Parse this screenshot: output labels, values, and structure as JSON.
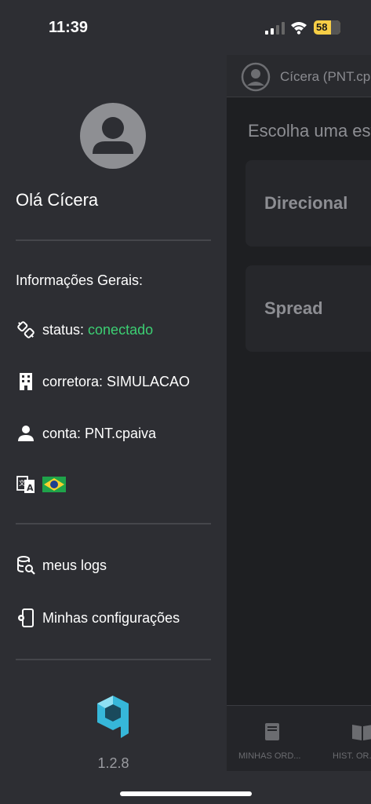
{
  "status_bar": {
    "time": "11:39",
    "battery": "58"
  },
  "drawer": {
    "greeting": "Olá Cícera",
    "section_title": "Informações Gerais:",
    "status_label": "status: ",
    "status_value": "conectado",
    "broker": "corretora: SIMULACAO",
    "account": "conta: PNT.cpaiva",
    "menu": {
      "logs": "meus logs",
      "settings": "Minhas configurações"
    },
    "version": "1.2.8"
  },
  "app": {
    "user": "Cícera (PNT.cpaiva)",
    "title": "Escolha uma estratégia",
    "strategies": [
      "Direcional",
      "Spread"
    ],
    "tabs": [
      "MINHAS ORD...",
      "HIST. OR..."
    ]
  },
  "colors": {
    "accent_green": "#3ccf73",
    "logo": "#36b7d9"
  }
}
